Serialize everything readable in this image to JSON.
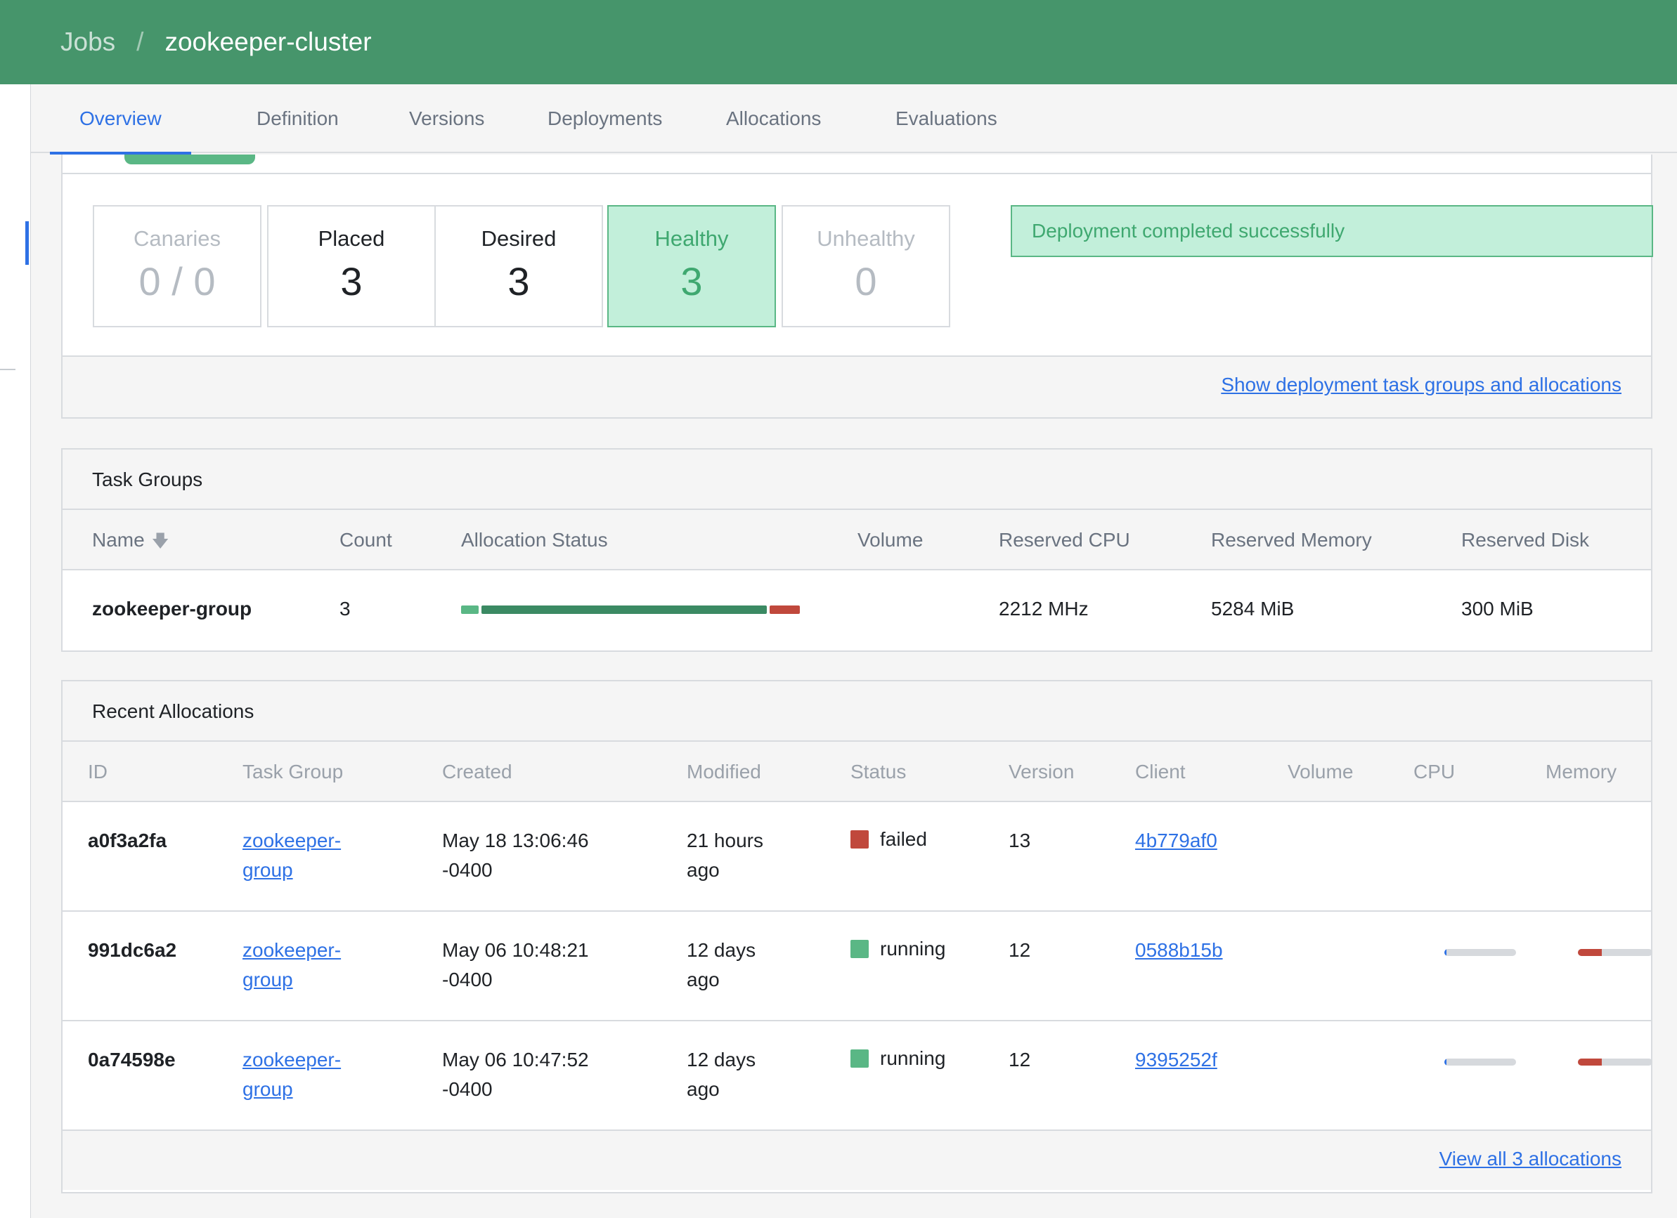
{
  "breadcrumb": {
    "root": "Jobs",
    "separator": "/",
    "current": "zookeeper-cluster"
  },
  "tabs": [
    {
      "label": "Overview",
      "active": true
    },
    {
      "label": "Definition",
      "active": false
    },
    {
      "label": "Versions",
      "active": false
    },
    {
      "label": "Deployments",
      "active": false
    },
    {
      "label": "Allocations",
      "active": false
    },
    {
      "label": "Evaluations",
      "active": false
    }
  ],
  "deployment": {
    "stats": {
      "canaries": {
        "label": "Canaries",
        "value": "0 / 0"
      },
      "placed": {
        "label": "Placed",
        "value": "3"
      },
      "desired": {
        "label": "Desired",
        "value": "3"
      },
      "healthy": {
        "label": "Healthy",
        "value": "3"
      },
      "unhealthy": {
        "label": "Unhealthy",
        "value": "0"
      }
    },
    "notice": "Deployment completed successfully",
    "show_link": "Show deployment task groups and allocations"
  },
  "task_groups": {
    "title": "Task Groups",
    "columns": {
      "name": "Name",
      "count": "Count",
      "allocation_status": "Allocation Status",
      "volume": "Volume",
      "reserved_cpu": "Reserved CPU",
      "reserved_memory": "Reserved Memory",
      "reserved_disk": "Reserved Disk"
    },
    "rows": [
      {
        "name": "zookeeper-group",
        "count": "3",
        "volume": "",
        "reserved_cpu": "2212 MHz",
        "reserved_memory": "5284 MiB",
        "reserved_disk": "300 MiB",
        "allocation_segments": [
          {
            "state": "starting",
            "fraction": 0.06
          },
          {
            "state": "running",
            "fraction": 0.85
          },
          {
            "state": "failed",
            "fraction": 0.09
          }
        ]
      }
    ]
  },
  "recent_allocations": {
    "title": "Recent Allocations",
    "columns": {
      "id": "ID",
      "task_group": "Task Group",
      "created": "Created",
      "modified": "Modified",
      "status": "Status",
      "version": "Version",
      "client": "Client",
      "volume": "Volume",
      "cpu": "CPU",
      "memory": "Memory"
    },
    "rows": [
      {
        "id": "a0f3a2fa",
        "task_group_1": "zookeeper-",
        "task_group_2": "group",
        "created_1": "May 18 13:06:46",
        "created_2": "-0400",
        "modified_1": "21 hours",
        "modified_2": "ago",
        "status": "failed",
        "version": "13",
        "client": "4b779af0",
        "cpu_fraction": null,
        "memory_fraction": null
      },
      {
        "id": "991dc6a2",
        "task_group_1": "zookeeper-",
        "task_group_2": "group",
        "created_1": "May 06 10:48:21",
        "created_2": "-0400",
        "modified_1": "12 days",
        "modified_2": "ago",
        "status": "running",
        "version": "12",
        "client": "0588b15b",
        "cpu_fraction": 0.03,
        "memory_fraction": 0.32
      },
      {
        "id": "0a74598e",
        "task_group_1": "zookeeper-",
        "task_group_2": "group",
        "created_1": "May 06 10:47:52",
        "created_2": "-0400",
        "modified_1": "12 days",
        "modified_2": "ago",
        "status": "running",
        "version": "12",
        "client": "9395252f",
        "cpu_fraction": 0.03,
        "memory_fraction": 0.32
      }
    ],
    "view_all": "View all 3 allocations"
  },
  "colors": {
    "header_green": "#46956b",
    "accent_blue": "#2e71e5",
    "healthy_bg": "#c2efda",
    "healthy_text": "#3fa870",
    "running": "#5ab785",
    "running_bar": "#3b8a63",
    "starting": "#5ab785",
    "failed": "#c0483c",
    "meter_track": "#d6d9dd"
  }
}
